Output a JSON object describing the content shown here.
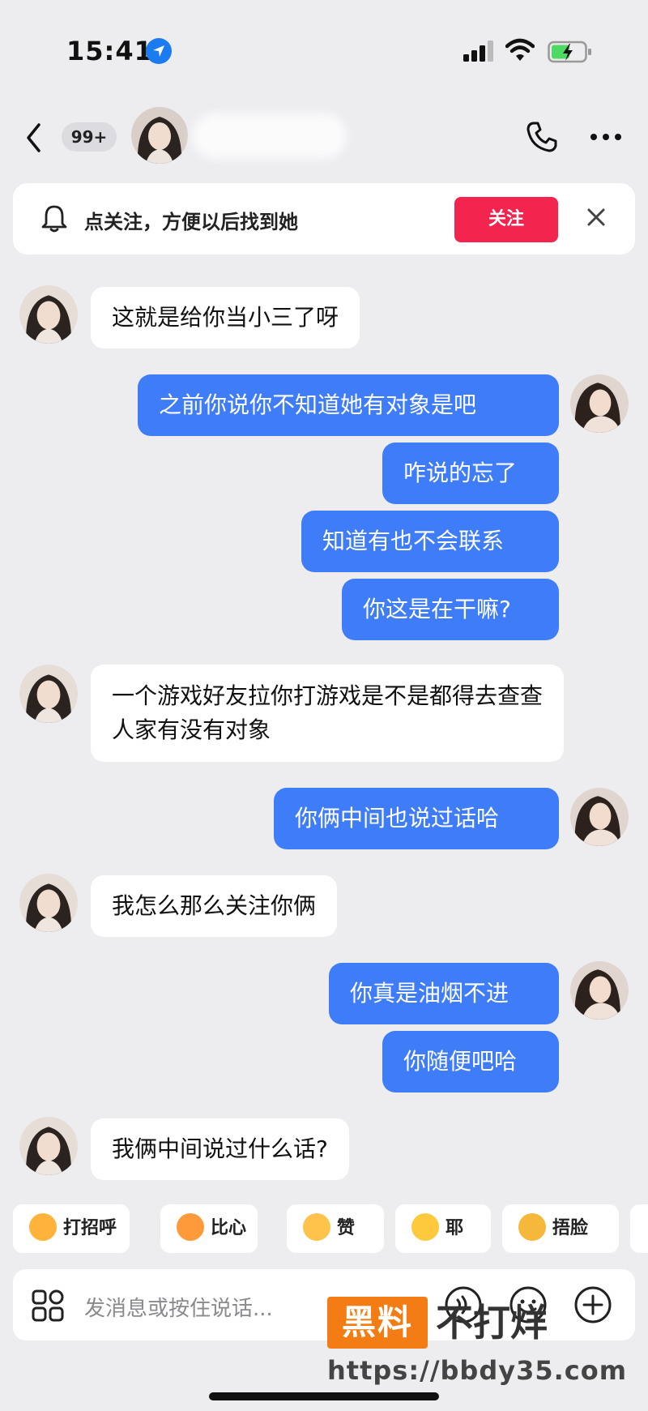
{
  "status_bar": {
    "time": "15:41"
  },
  "header": {
    "unread_badge": "99+"
  },
  "follow_banner": {
    "text": "点关注，方便以后找到她",
    "button": "关注"
  },
  "messages": [
    {
      "side": "in",
      "text": "这就是给你当小三了呀"
    },
    {
      "side": "out",
      "text": "之前你说你不知道她有对象是吧"
    },
    {
      "side": "out",
      "text": "咋说的忘了"
    },
    {
      "side": "out",
      "text": "知道有也不会联系"
    },
    {
      "side": "out",
      "text": "你这是在干嘛?"
    },
    {
      "side": "in",
      "text": "一个游戏好友拉你打游戏是不是都得去查查人家有没有对象"
    },
    {
      "side": "out",
      "text": "你俩中间也说过话哈"
    },
    {
      "side": "in",
      "text": "我怎么那么关注你俩"
    },
    {
      "side": "out",
      "text": "你真是油烟不进"
    },
    {
      "side": "out",
      "text": "你随便吧哈"
    },
    {
      "side": "in",
      "text": "我俩中间说过什么话?"
    }
  ],
  "quick_replies": [
    {
      "label": "打招呼",
      "icon": "smile-emoji-icon"
    },
    {
      "label": "比心",
      "icon": "heart-hands-emoji-icon"
    },
    {
      "label": "赞",
      "icon": "thumbs-up-emoji-icon"
    },
    {
      "label": "耶",
      "icon": "yeah-emoji-icon"
    },
    {
      "label": "捂脸",
      "icon": "facepalm-emoji-icon"
    }
  ],
  "input": {
    "placeholder": "发消息或按住说话..."
  },
  "watermark": {
    "badge": "黑料",
    "text": "不打烊",
    "url": "https://bbdy35.com"
  },
  "colors": {
    "outgoing_bubble": "#3f7cf7",
    "follow_button": "#f3244e",
    "watermark": "#f37d14"
  }
}
